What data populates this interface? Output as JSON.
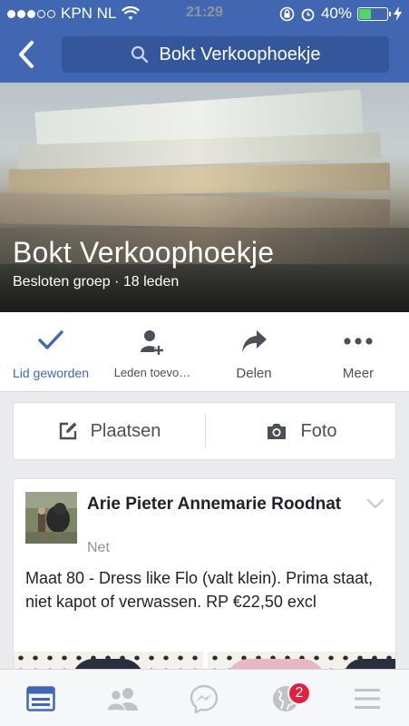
{
  "status_bar": {
    "carrier": "KPN NL",
    "time": "21:29",
    "battery": "40%",
    "battery_level": 0.4,
    "signal_bars_filled": 3,
    "signal_bars_total": 5
  },
  "nav": {
    "search_text": "Bokt Verkoophoekje"
  },
  "group": {
    "name": "Bokt Verkoophoekje",
    "subtitle": "Besloten groep · 18 leden"
  },
  "actions": [
    {
      "label": "Lid geworden",
      "icon": "checkmark-icon"
    },
    {
      "label": "Leden toevo…",
      "icon": "add-person-icon"
    },
    {
      "label": "Delen",
      "icon": "share-icon"
    },
    {
      "label": "Meer",
      "icon": "more-icon"
    }
  ],
  "composer": {
    "post_label": "Plaatsen",
    "photo_label": "Foto"
  },
  "post": {
    "author": "Arie Pieter Annemarie Roodnat",
    "time": "Net",
    "text": "Maat 80 - Dress like Flo (valt klein). Prima staat, niet kapot of verwassen. RP €22,50 excl"
  },
  "tabbar": {
    "notifications_badge": "2",
    "tabs": [
      "news-feed-icon",
      "friends-icon",
      "messenger-icon",
      "globe-icon",
      "menu-icon"
    ]
  },
  "colors": {
    "brand": "#4267b2",
    "search_bg": "#34569a",
    "badge": "#e41e3f",
    "battery": "#4cd964"
  }
}
